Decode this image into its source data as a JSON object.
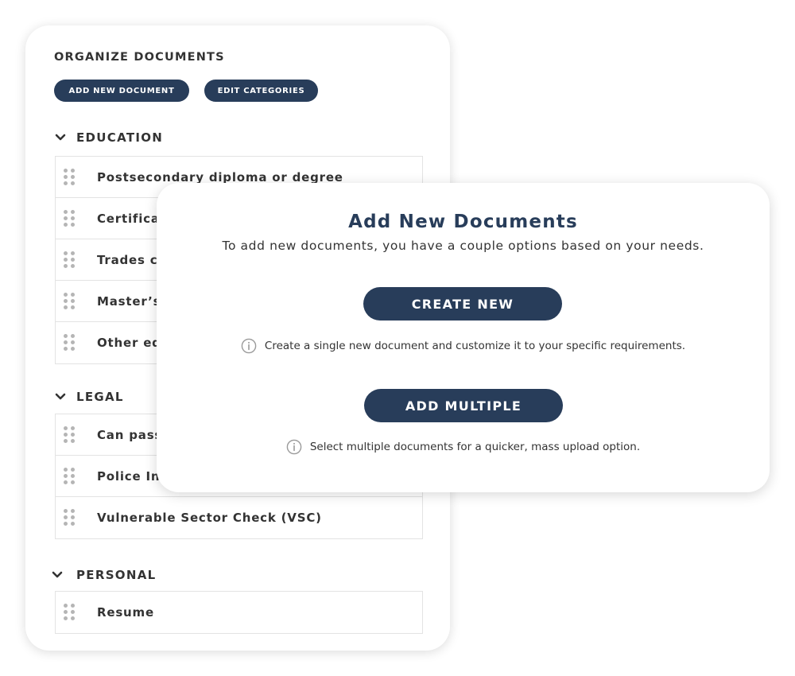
{
  "panel": {
    "title": "ORGANIZE DOCUMENTS",
    "add_button": "ADD NEW DOCUMENT",
    "edit_button": "EDIT CATEGORIES",
    "categories": [
      {
        "name": "EDUCATION",
        "items": [
          "Postsecondary diploma or degree",
          "Certifica",
          "Trades c",
          "Master’s",
          "Other ed"
        ]
      },
      {
        "name": "LEGAL",
        "items": [
          "Can pass",
          "Police Inv",
          "Vulnerable Sector Check (VSC)"
        ]
      },
      {
        "name": "PERSONAL",
        "items": [
          "Resume"
        ]
      }
    ]
  },
  "modal": {
    "title": "Add New Documents",
    "subtitle": "To add new documents, you have a couple options based on your needs.",
    "create_button": "CREATE NEW",
    "create_hint": "Create a single new document and customize it to your specific requirements.",
    "multiple_button": "ADD MULTIPLE",
    "multiple_hint": "Select multiple documents for a quicker, mass upload option."
  },
  "icons": {
    "chevron": "chevron-down-icon",
    "grip": "drag-handle-icon",
    "info": "info-icon"
  },
  "colors": {
    "primary": "#283d5a",
    "text": "#333333",
    "border": "#e3e3e3",
    "grip": "#b5b5b5"
  }
}
